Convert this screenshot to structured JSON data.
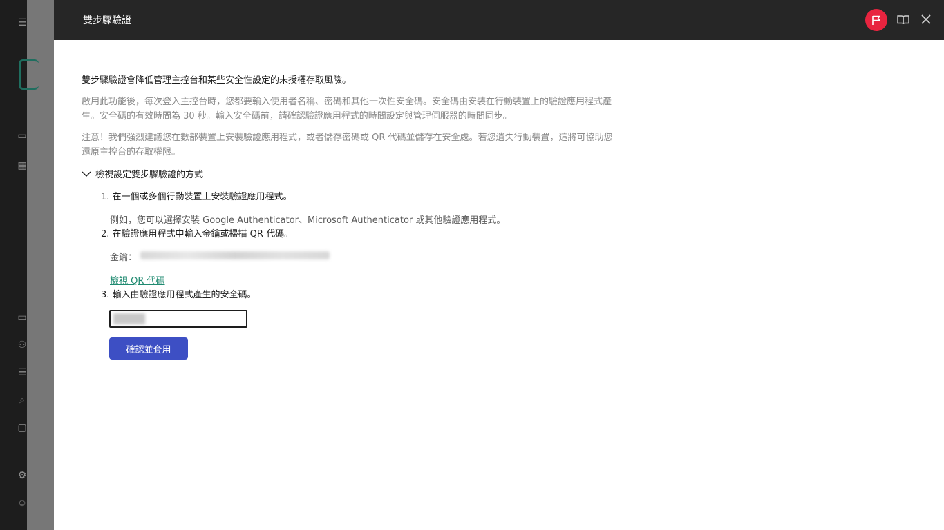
{
  "modal": {
    "title": "雙步驟驗證",
    "intro": "雙步驟驗證會降低管理主控台和某些安全性設定的未授權存取風險。",
    "description": "啟用此功能後，每次登入主控台時，您都要輸入使用者名稱、密碼和其他一次性安全碼。安全碼由安裝在行動裝置上的驗證應用程式產生。安全碼的有效時間為 30 秒。輸入安全碼前，請確認驗證應用程式的時間設定與管理伺服器的時間同步。",
    "warning": "注意！我們強烈建議您在數部裝置上安裝驗證應用程式，或者儲存密碼或 QR 代碼並儲存在安全處。若您遺失行動裝置，這將可協助您還原主控台的存取權限。",
    "expander_label": "檢視設定雙步驟驗證的方式",
    "steps": [
      {
        "text": "1. 在一個或多個行動裝置上安裝驗證應用程式。",
        "example": "例如，您可以選擇安裝 Google Authenticator、Microsoft Authenticator 或其他驗證應用程式。"
      },
      {
        "text": "2. 在驗證應用程式中輸入金鑰或掃描 QR 代碼。",
        "key_label": "金鑰：",
        "qr_link": "檢視 QR 代碼"
      },
      {
        "text": "3. 輸入由驗證應用程式產生的安全碼。"
      }
    ],
    "confirm_button": "確認並套用"
  },
  "header_icons": [
    "flag-icon",
    "book-icon",
    "close-icon"
  ],
  "colors": {
    "header_bg": "#262626",
    "accent_button": "#3d4fc4",
    "flag_bg": "#e8243f",
    "link": "#1f8a70"
  }
}
